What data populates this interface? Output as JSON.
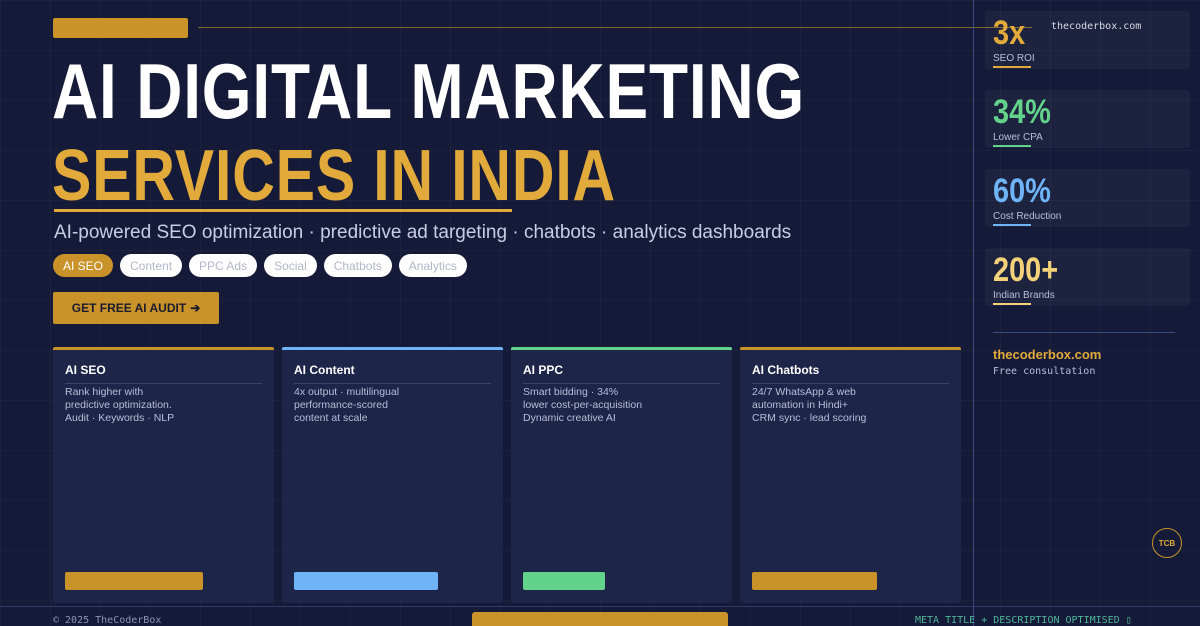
{
  "hero": {
    "title_line1": "AI DIGITAL MARKETING",
    "title_line2": "SERVICES IN INDIA",
    "subtitle": "AI-powered SEO optimization · predictive ad targeting · chatbots · analytics dashboards"
  },
  "tags": [
    {
      "label": "AI SEO",
      "active": true
    },
    {
      "label": "Content",
      "active": false
    },
    {
      "label": "PPC Ads",
      "active": false
    },
    {
      "label": "Social",
      "active": false
    },
    {
      "label": "Chatbots",
      "active": false
    },
    {
      "label": "Analytics",
      "active": false
    }
  ],
  "cta": {
    "label": "GET FREE AI AUDIT",
    "arrow": "➔"
  },
  "cards": [
    {
      "title": "AI SEO",
      "accent": "#c9932a",
      "lines": [
        "Rank higher with",
        "predictive optimization.",
        "Audit · Keywords · NLP"
      ]
    },
    {
      "title": "AI Content",
      "accent": "#6eb4f7",
      "lines": [
        "4x output · multilingual",
        "performance-scored",
        "content at scale"
      ]
    },
    {
      "title": "AI PPC",
      "accent": "#63d38b",
      "lines": [
        "Smart bidding · 34%",
        "lower cost-per-acquisition",
        "Dynamic creative AI"
      ]
    },
    {
      "title": "AI Chatbots",
      "accent": "#c9932a",
      "lines": [
        "24/7 WhatsApp & web",
        "automation in Hindi+",
        "CRM sync · lead scoring"
      ]
    }
  ],
  "stats": [
    {
      "value": "3x",
      "label": "SEO ROI",
      "color": "#e2a93b"
    },
    {
      "value": "34%",
      "label": "Lower CPA",
      "color": "#63d38b"
    },
    {
      "value": "60%",
      "label": "Cost Reduction",
      "color": "#6eb4f7"
    },
    {
      "value": "200+",
      "label": "Indian Brands",
      "color": "#f4d27a"
    }
  ],
  "site_tag": "thecoderbox.com",
  "sidebar": {
    "brand": "thecoderbox.com",
    "sub": "Free consultation"
  },
  "badge": "TCB",
  "footer": {
    "left": "© 2025   TheCoderBox",
    "right": "META TITLE + DESCRIPTION OPTIMISED  ▯"
  }
}
